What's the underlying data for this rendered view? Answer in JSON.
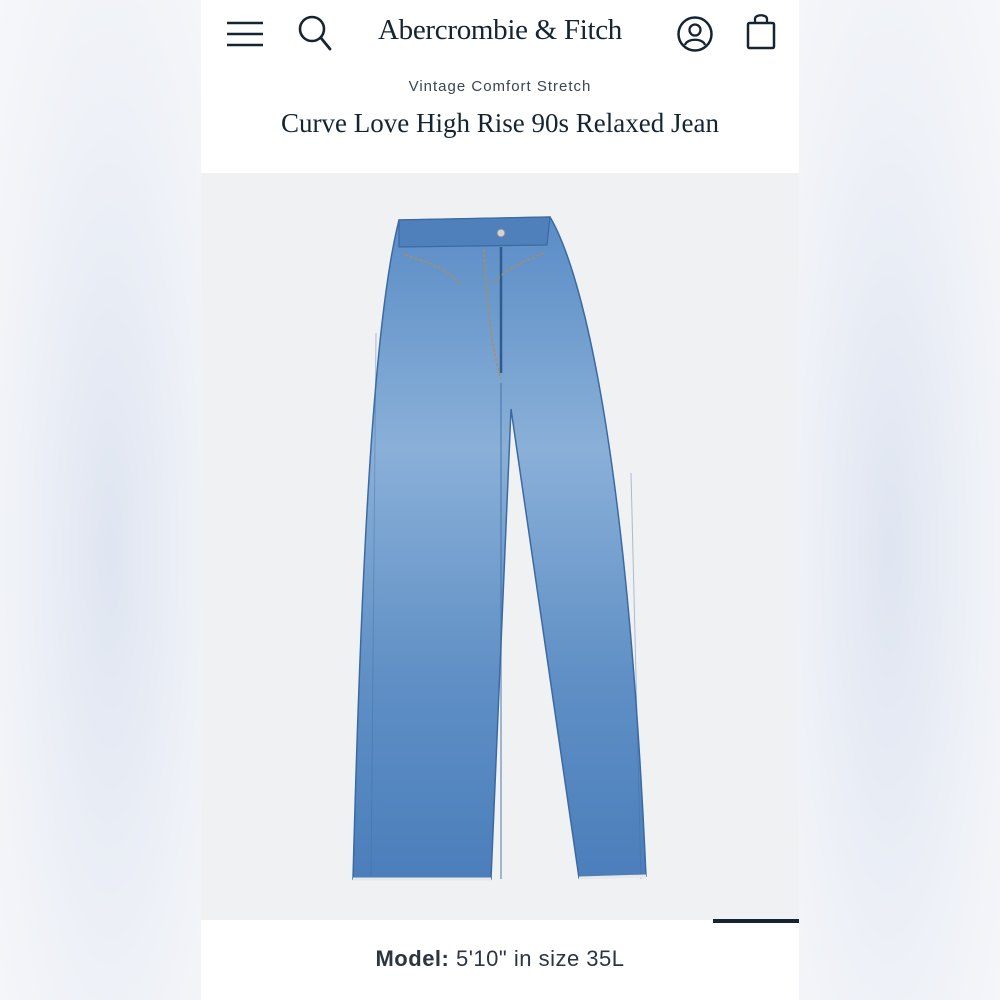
{
  "header": {
    "brand": "Abercrombie & Fitch",
    "icons": [
      "hamburger-menu-icon",
      "search-icon",
      "account-icon",
      "shopping-bag-icon"
    ]
  },
  "product": {
    "collection": "Vintage Comfort Stretch",
    "title": "Curve Love High Rise 90s Relaxed Jean",
    "image": "medium-wash-blue-relaxed-jeans"
  },
  "model": {
    "label": "Model:",
    "value": "5'10\" in size 35L"
  },
  "colors": {
    "brand_navy": "#142433",
    "denim": "#4f82bd",
    "image_bg": "#f0f1f3"
  }
}
